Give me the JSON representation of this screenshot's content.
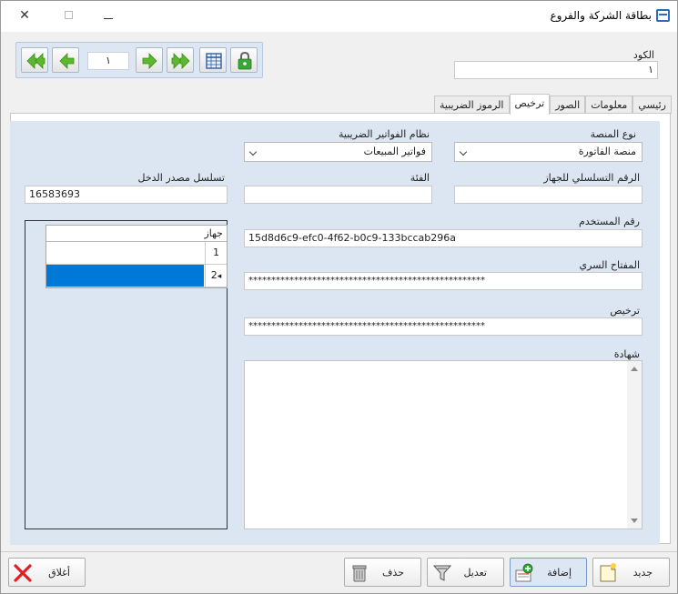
{
  "window": {
    "title": "بطاقة الشركة والفروع"
  },
  "nav": {
    "record_number": "١"
  },
  "header": {
    "code_label": "الكود",
    "code_value": "١"
  },
  "tabs": [
    {
      "label": "رئيسي"
    },
    {
      "label": "معلومات"
    },
    {
      "label": "الصور"
    },
    {
      "label": "ترخيص"
    },
    {
      "label": "الرموز الضريبية"
    }
  ],
  "license": {
    "platform_type_label": "نوع المنصة",
    "platform_type_value": "منصة الفاتورة",
    "invoice_system_label": "نظام الفواتير الضريبية",
    "invoice_system_value": "فواتير المبيعات",
    "device_serial_label": "الرقم التسلسلي للجهاز",
    "device_serial_value": "",
    "category_label": "الفئة",
    "category_value": "",
    "income_source_label": "تسلسل مصدر الدخل",
    "income_source_value": "16583693",
    "username_label": "رقم المستخدم",
    "username_value": "15d8d6c9-efc0-4f62-b0c9-133bccab296a",
    "secret_key_label": "المفتاح السري",
    "secret_key_value": "****************************************************",
    "license_label": "ترخيص",
    "license_value": "****************************************************",
    "certificate_label": "شهادة",
    "certificate_value": ""
  },
  "device_grid": {
    "column_header": "جهاز",
    "rows": [
      {
        "num": "1",
        "value": ""
      },
      {
        "num": "2",
        "value": ""
      }
    ]
  },
  "actions": {
    "new_label": "جديد",
    "add_label": "إضافة",
    "edit_label": "تعديل",
    "delete_label": "حذف",
    "close_label": "أغلاق"
  },
  "colors": {
    "selection": "#0078d7",
    "panel": "#dbe6f2",
    "nav_green": "#5cb82e"
  }
}
